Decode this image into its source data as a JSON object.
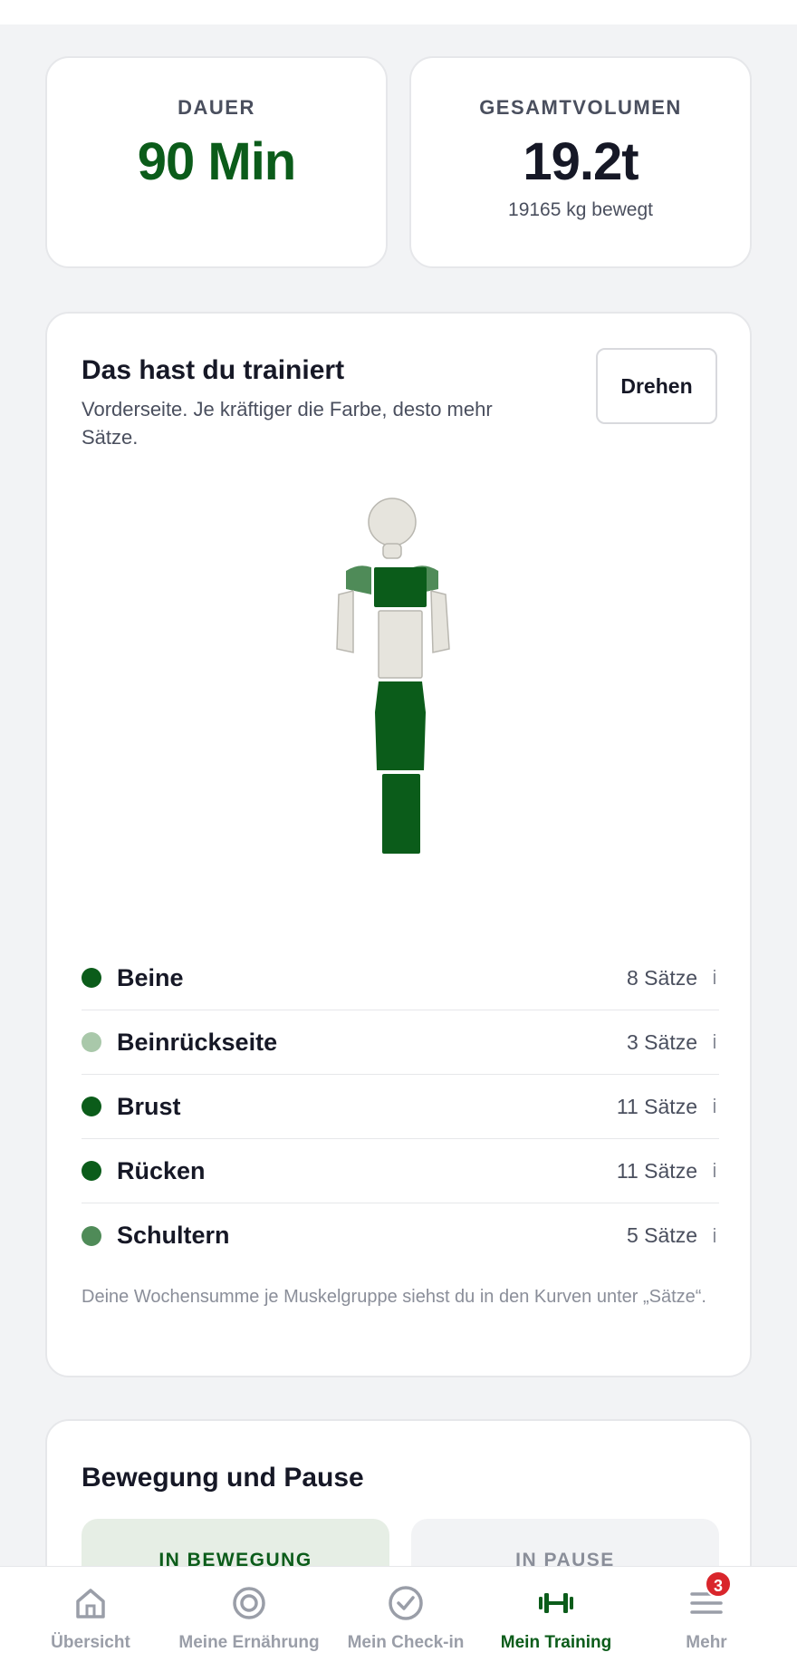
{
  "stats": {
    "duration": {
      "label": "DAUER",
      "value": "90 Min"
    },
    "volume": {
      "label": "GESAMTVOLUMEN",
      "value": "19.2t",
      "sub": "19165 kg bewegt"
    }
  },
  "muscles": {
    "title": "Das hast du trainiert",
    "description": "Vorderseite. Je kräftiger die Farbe, desto mehr Sätze.",
    "rotate_label": "Drehen",
    "figure_colors": {
      "untrained": "#e6e4dd",
      "shoulders": "#4f8b58",
      "strong": "#0b5c1a"
    },
    "groups": [
      {
        "name": "Beine",
        "count": "8 Sätze",
        "info": "i",
        "color": "#0b5c1a"
      },
      {
        "name": "Beinrückseite",
        "count": "3 Sätze",
        "info": "i",
        "color": "#a9c8aa"
      },
      {
        "name": "Brust",
        "count": "11 Sätze",
        "info": "i",
        "color": "#0b5c1a"
      },
      {
        "name": "Rücken",
        "count": "11 Sätze",
        "info": "i",
        "color": "#0b5c1a"
      },
      {
        "name": "Schultern",
        "count": "5 Sätze",
        "info": "i",
        "color": "#4f8b58"
      }
    ],
    "footnote": "Deine Wochensumme je Muskelgruppe siehst du in den Kurven unter „Sätze“."
  },
  "movement": {
    "title": "Bewegung und Pause",
    "active_label": "IN BEWEGUNG",
    "pause_label": "IN PAUSE"
  },
  "tabbar": {
    "tabs": [
      {
        "label": "Übersicht",
        "icon": "home-icon"
      },
      {
        "label": "Meine Ernährung",
        "icon": "target-icon"
      },
      {
        "label": "Mein Check-in",
        "icon": "check-circle-icon"
      },
      {
        "label": "Mein Training",
        "icon": "dumbbell-icon",
        "active": true
      },
      {
        "label": "Mehr",
        "icon": "menu-icon",
        "badge": "3"
      }
    ]
  }
}
